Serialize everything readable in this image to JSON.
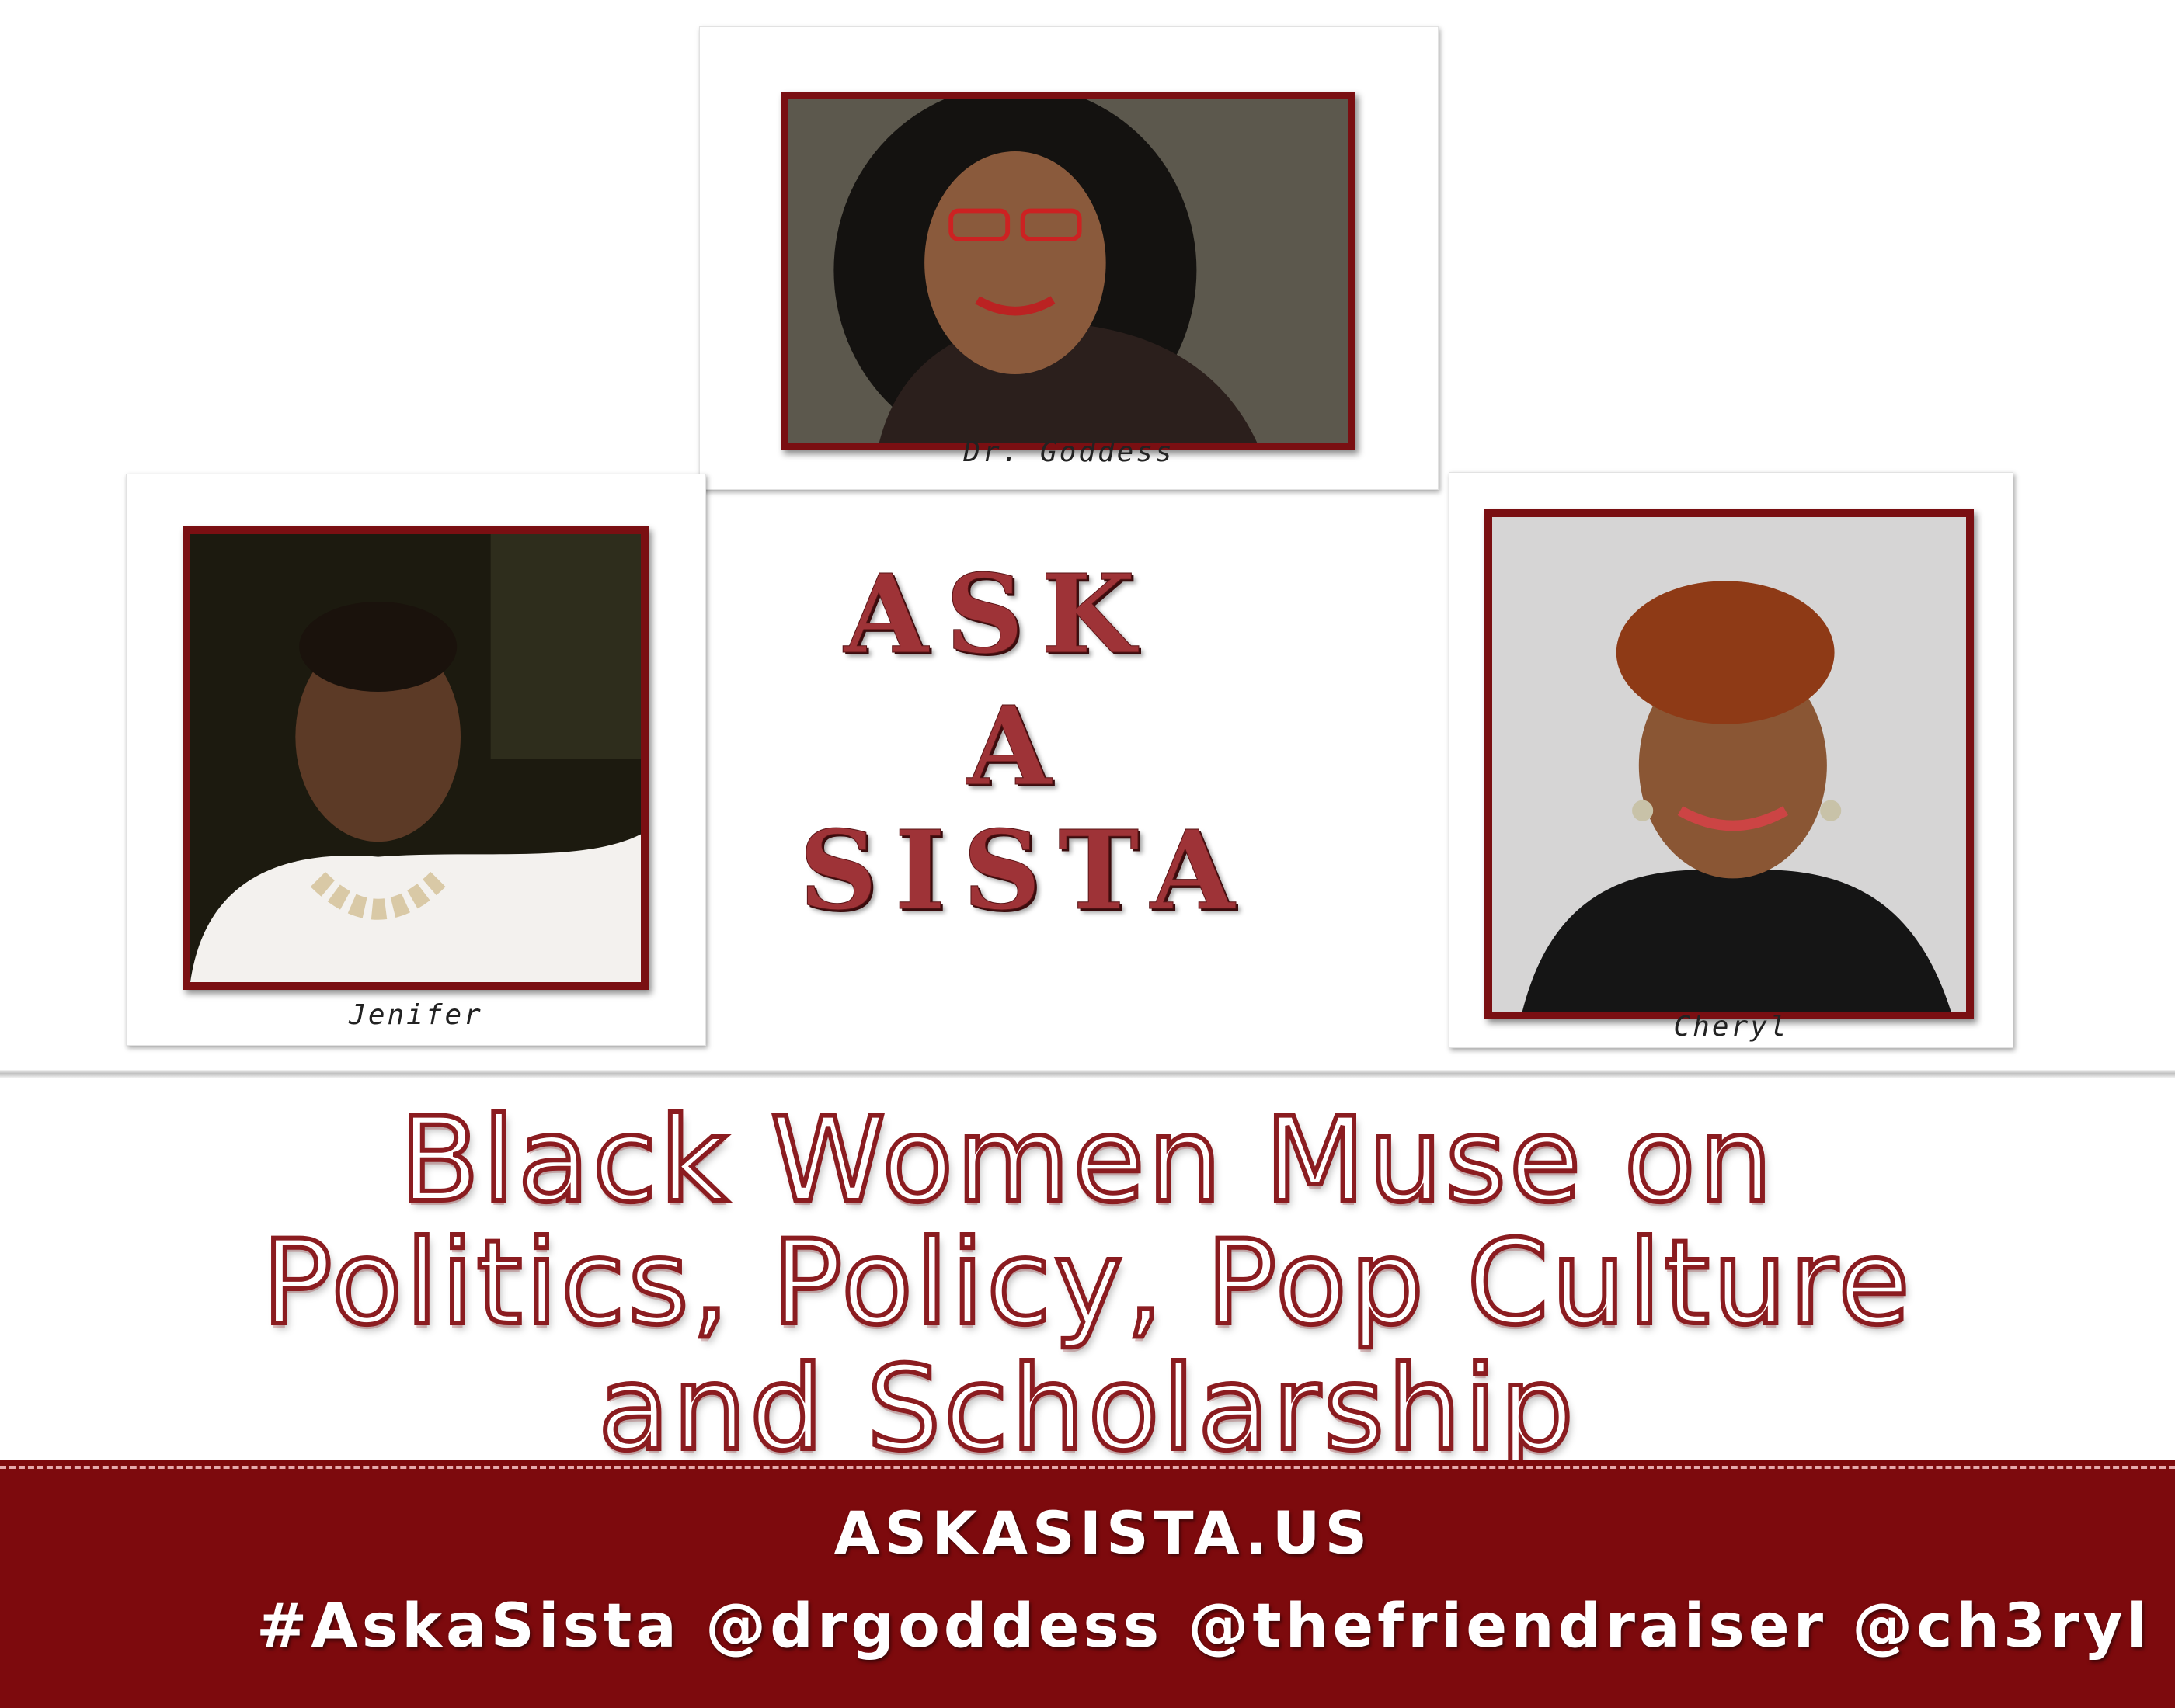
{
  "hosts": [
    {
      "name": "Dr. Goddess",
      "position": "top"
    },
    {
      "name": "Jenifer",
      "position": "left"
    },
    {
      "name": "Cheryl",
      "position": "right"
    }
  ],
  "logo": {
    "line1": "ASK",
    "line2": "A",
    "line3": "SISTA"
  },
  "tagline": {
    "line1": "Black Women Muse on",
    "line2": "Politics, Policy, Pop Culture",
    "line3": "and Scholarship"
  },
  "footer": {
    "url": "ASKASISTA.US",
    "handles": "#AskaSista @drgoddess @thefriendraiser @ch3ryl"
  },
  "colors": {
    "accent": "#7d0a0d",
    "logo_fill": "#9e3337"
  }
}
